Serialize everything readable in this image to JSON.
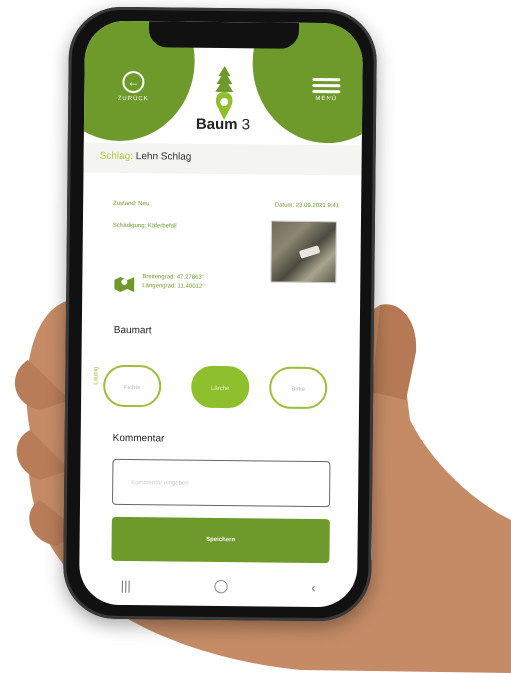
{
  "header": {
    "back_label": "ZURÜCK",
    "menu_label": "MENÜ",
    "title": "Baum",
    "title_num": "3"
  },
  "schlag": {
    "key": "Schlag:",
    "value": "Lehn Schlag"
  },
  "details": {
    "left_1": "Zustand: Neu",
    "right_1": "Datum: 23.09.2021 9:41",
    "left_2": "Schädigung: Käferbefall"
  },
  "gps": {
    "line1": "Breitengrad: 47.27863°",
    "line2": "Längengrad: 11.40012°"
  },
  "baumart": {
    "label": "Baumart",
    "side_label": "Laubig",
    "options": [
      "Fichte",
      "Lärche",
      "Birke"
    ],
    "selected_index": 1
  },
  "kommentar": {
    "label": "Kommentar",
    "placeholder": "Kommentar eingeben"
  },
  "save_label": "Speichern",
  "navbar": {
    "recent": "|||",
    "home": "◯",
    "back": "‹"
  },
  "colors": {
    "primary": "#6e9a2c",
    "selected": "#8ec02e",
    "accent": "#b6cf3c"
  }
}
